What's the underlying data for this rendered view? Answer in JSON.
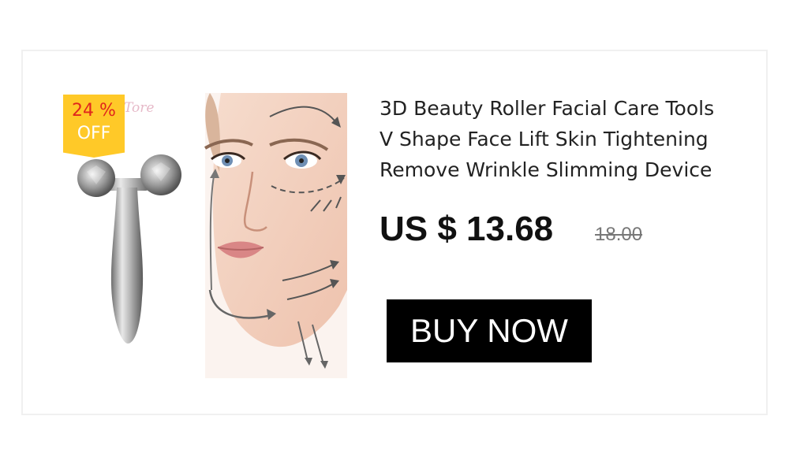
{
  "badge": {
    "percent": "24 %",
    "label": "OFF"
  },
  "watermark": "Tore",
  "product": {
    "title_lines": [
      "3D Beauty Roller Facial Care Tools",
      "V Shape Face Lift Skin Tightening",
      "Remove Wrinkle Slimming Device"
    ],
    "price": "US $ 13.68",
    "original_price": "18.00"
  },
  "cta": {
    "label": "BUY NOW"
  },
  "colors": {
    "badge_background": "#ffc928",
    "badge_percent": "#e0261c",
    "button_background": "#000000",
    "button_text": "#ffffff"
  }
}
